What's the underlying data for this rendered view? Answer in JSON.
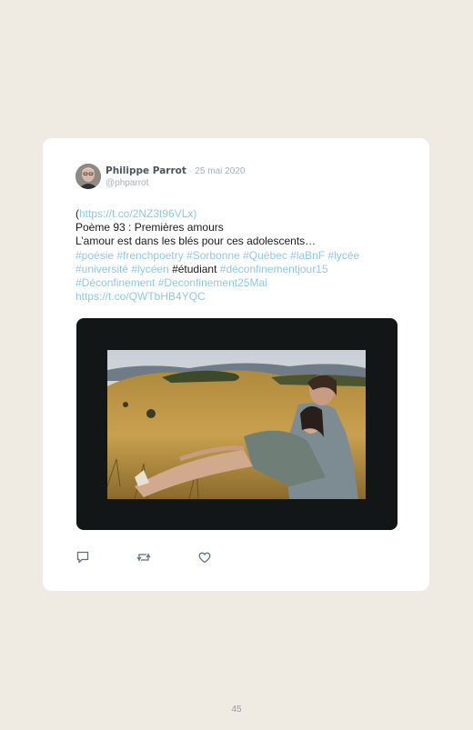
{
  "tweet": {
    "author_name": "Philippe Parrot",
    "separator": "·",
    "date": "25 mai 2020",
    "handle": "@phparrot",
    "lines": [
      {
        "segments": [
          {
            "text": "(",
            "link": false
          },
          {
            "text": "https://t.co/2NZ3t96VLx)",
            "link": true
          }
        ]
      },
      {
        "segments": [
          {
            "text": "Poème 93 : Premières amours",
            "link": false
          }
        ]
      },
      {
        "segments": [
          {
            "text": "L’amour est dans les blés pour ces adolescents…",
            "link": false
          }
        ]
      },
      {
        "segments": [
          {
            "text": "#poésie #frenchpoetry #Sorbonne #Québec #laBnF #lycée",
            "link": true
          }
        ]
      },
      {
        "segments": [
          {
            "text": "#université #lycéen ",
            "link": true
          },
          {
            "text": "#étudiant",
            "link": false
          },
          {
            "text": " #déconfinementjour15",
            "link": true
          }
        ]
      },
      {
        "segments": [
          {
            "text": "#Déconfinement #Deconfinement25Mai",
            "link": true
          }
        ]
      },
      {
        "segments": [
          {
            "text": "https://t.co/QWTbHB4YQC",
            "link": true
          }
        ]
      }
    ],
    "actions": [
      {
        "name": "reply-icon"
      },
      {
        "name": "retweet-icon"
      },
      {
        "name": "like-icon"
      }
    ],
    "colors": {
      "link": "#8ec9e9",
      "text": "#1a1a1a",
      "muted": "#a8b0b8",
      "page_bg": "#efebe2"
    }
  },
  "page_number": "45"
}
